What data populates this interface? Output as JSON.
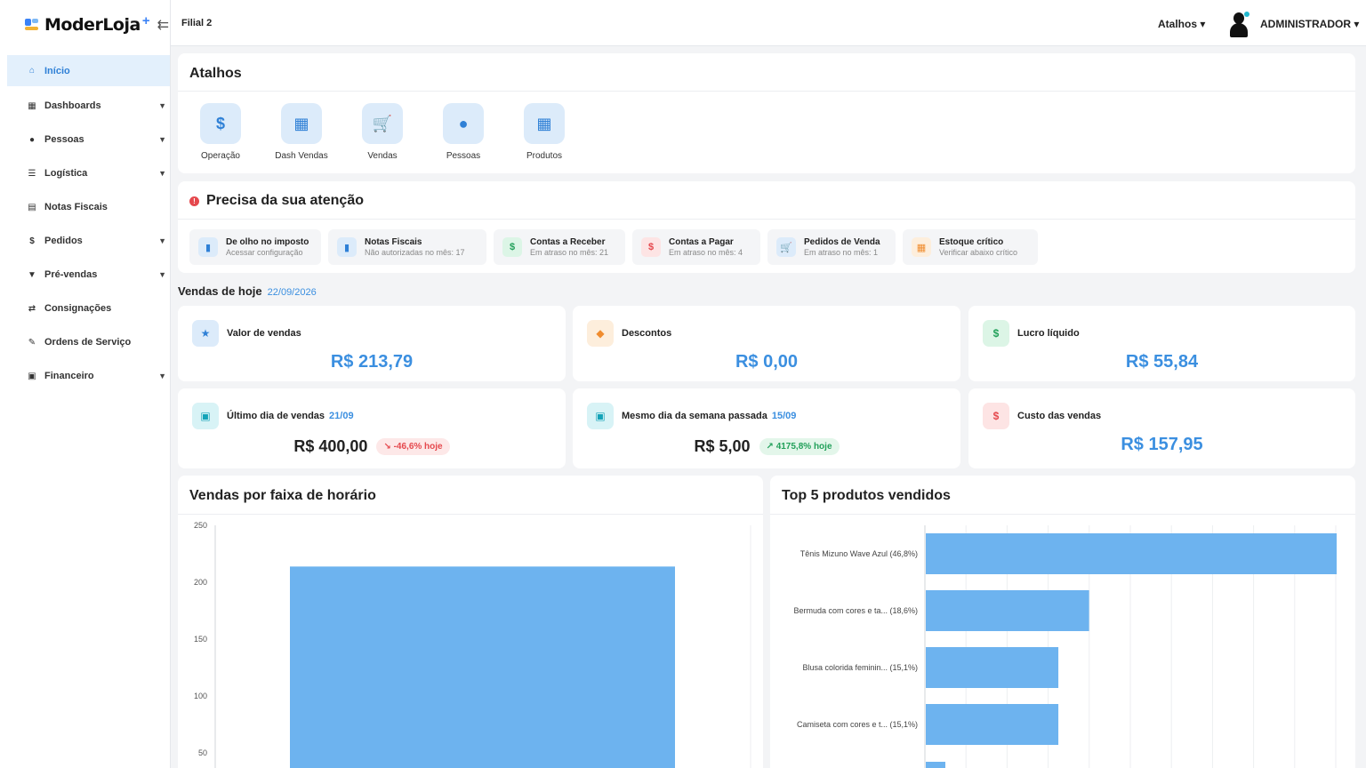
{
  "app": {
    "logo_text": "ModerLoja",
    "logo_plus": "+",
    "branch": "Filial 2"
  },
  "topbar": {
    "shortcuts_menu": "Atalhos ▾",
    "user": "ADMINISTRADOR ▾"
  },
  "sidebar": {
    "items": [
      {
        "label": "Início",
        "icon": "home-icon",
        "glyph": "⌂",
        "active": true,
        "has_children": false
      },
      {
        "label": "Dashboards",
        "icon": "dashboard-icon",
        "glyph": "▦",
        "active": false,
        "has_children": true
      },
      {
        "label": "Pessoas",
        "icon": "person-icon",
        "glyph": "●",
        "active": false,
        "has_children": true
      },
      {
        "label": "Logística",
        "icon": "logistics-icon",
        "glyph": "☰",
        "active": false,
        "has_children": true
      },
      {
        "label": "Notas Fiscais",
        "icon": "invoice-icon",
        "glyph": "▤",
        "active": false,
        "has_children": false
      },
      {
        "label": "Pedidos",
        "icon": "dollar-icon",
        "glyph": "$",
        "active": false,
        "has_children": true
      },
      {
        "label": "Pré-vendas",
        "icon": "basket-icon",
        "glyph": "▼",
        "active": false,
        "has_children": true
      },
      {
        "label": "Consignações",
        "icon": "swap-icon",
        "glyph": "⇄",
        "active": false,
        "has_children": false
      },
      {
        "label": "Ordens de Serviço",
        "icon": "wrench-icon",
        "glyph": "✎",
        "active": false,
        "has_children": false
      },
      {
        "label": "Financeiro",
        "icon": "finance-icon",
        "glyph": "▣",
        "active": false,
        "has_children": true
      }
    ]
  },
  "shortcuts": {
    "title": "Atalhos",
    "items": [
      {
        "label": "Operação",
        "glyph": "$",
        "icon": "dollar-icon"
      },
      {
        "label": "Dash Vendas",
        "glyph": "▦",
        "icon": "dashboard-icon"
      },
      {
        "label": "Vendas",
        "glyph": "🛒",
        "icon": "cart-icon"
      },
      {
        "label": "Pessoas",
        "glyph": "●",
        "icon": "person-icon"
      },
      {
        "label": "Produtos",
        "glyph": "▦",
        "icon": "products-icon"
      }
    ]
  },
  "attention": {
    "title": "Precisa da sua atenção",
    "alert_glyph": "!",
    "items": [
      {
        "title": "De olho no imposto",
        "subtitle": "Acessar configuração",
        "glyph": "▮",
        "icon": "document-icon",
        "bg": "#dcebfa",
        "fg": "#2f80d6"
      },
      {
        "title": "Notas Fiscais",
        "subtitle": "Não autorizadas no mês: 17",
        "glyph": "▮",
        "icon": "document-icon",
        "bg": "#dcebfa",
        "fg": "#2f80d6"
      },
      {
        "title": "Contas a Receber",
        "subtitle": "Em atraso no mês: 21",
        "glyph": "$",
        "icon": "dollar-icon",
        "bg": "#dcf5e6",
        "fg": "#22a05a"
      },
      {
        "title": "Contas a Pagar",
        "subtitle": "Em atraso no mês: 4",
        "glyph": "$",
        "icon": "dollar-icon",
        "bg": "#fde4e4",
        "fg": "#e5484d"
      },
      {
        "title": "Pedidos de Venda",
        "subtitle": "Em atraso no mês: 1",
        "glyph": "🛒",
        "icon": "cart-icon",
        "bg": "#dcebfa",
        "fg": "#2f80d6"
      },
      {
        "title": "Estoque crítico",
        "subtitle": "Verificar abaixo crítico",
        "glyph": "▦",
        "icon": "stock-icon",
        "bg": "#fdeedc",
        "fg": "#f08c2e"
      }
    ]
  },
  "sales_today": {
    "title": "Vendas de hoje",
    "date": "22/09/2026"
  },
  "kpis": {
    "valor": {
      "label": "Valor de vendas",
      "value": "R$ 213,79",
      "glyph": "★",
      "bg": "#dcebfa",
      "fg": "#2f80d6"
    },
    "descontos": {
      "label": "Descontos",
      "value": "R$ 0,00",
      "glyph": "◆",
      "bg": "#fdeedc",
      "fg": "#f08c2e"
    },
    "lucro": {
      "label": "Lucro líquido",
      "value": "R$ 55,84",
      "glyph": "$",
      "bg": "#dcf5e6",
      "fg": "#22a05a"
    },
    "ultimo": {
      "label": "Último dia de vendas",
      "date": "21/09",
      "value": "R$ 400,00",
      "badge": "↘ -46,6% hoje",
      "glyph": "▣",
      "bg": "#d8f3f6",
      "fg": "#14a3b8"
    },
    "mesmo": {
      "label": "Mesmo dia da semana passada",
      "date": "15/09",
      "value": "R$ 5,00",
      "badge": "↗ 4175,8% hoje",
      "glyph": "▣",
      "bg": "#d8f3f6",
      "fg": "#14a3b8"
    },
    "custo": {
      "label": "Custo das vendas",
      "value": "R$ 157,95",
      "glyph": "$",
      "bg": "#fde4e4",
      "fg": "#e5484d"
    }
  },
  "chart_data": [
    {
      "type": "bar",
      "title": "Vendas por faixa de horário",
      "ylim": [
        0,
        250
      ],
      "yticks": [
        50,
        100,
        150,
        200,
        250
      ],
      "categories": [
        ""
      ],
      "values": [
        213.79
      ],
      "color": "#6db3ef"
    },
    {
      "type": "bar",
      "orientation": "horizontal",
      "title": "Top 5 produtos vendidos",
      "categories": [
        "Tênis Mizuno Wave Azul (46,8%)",
        "Bermuda com cores e ta... (18,6%)",
        "Blusa colorida feminin... (15,1%)",
        "Camiseta com cores e t... (15,1%)"
      ],
      "values": [
        46.8,
        18.6,
        15.1,
        15.1
      ],
      "color": "#6db3ef"
    }
  ]
}
